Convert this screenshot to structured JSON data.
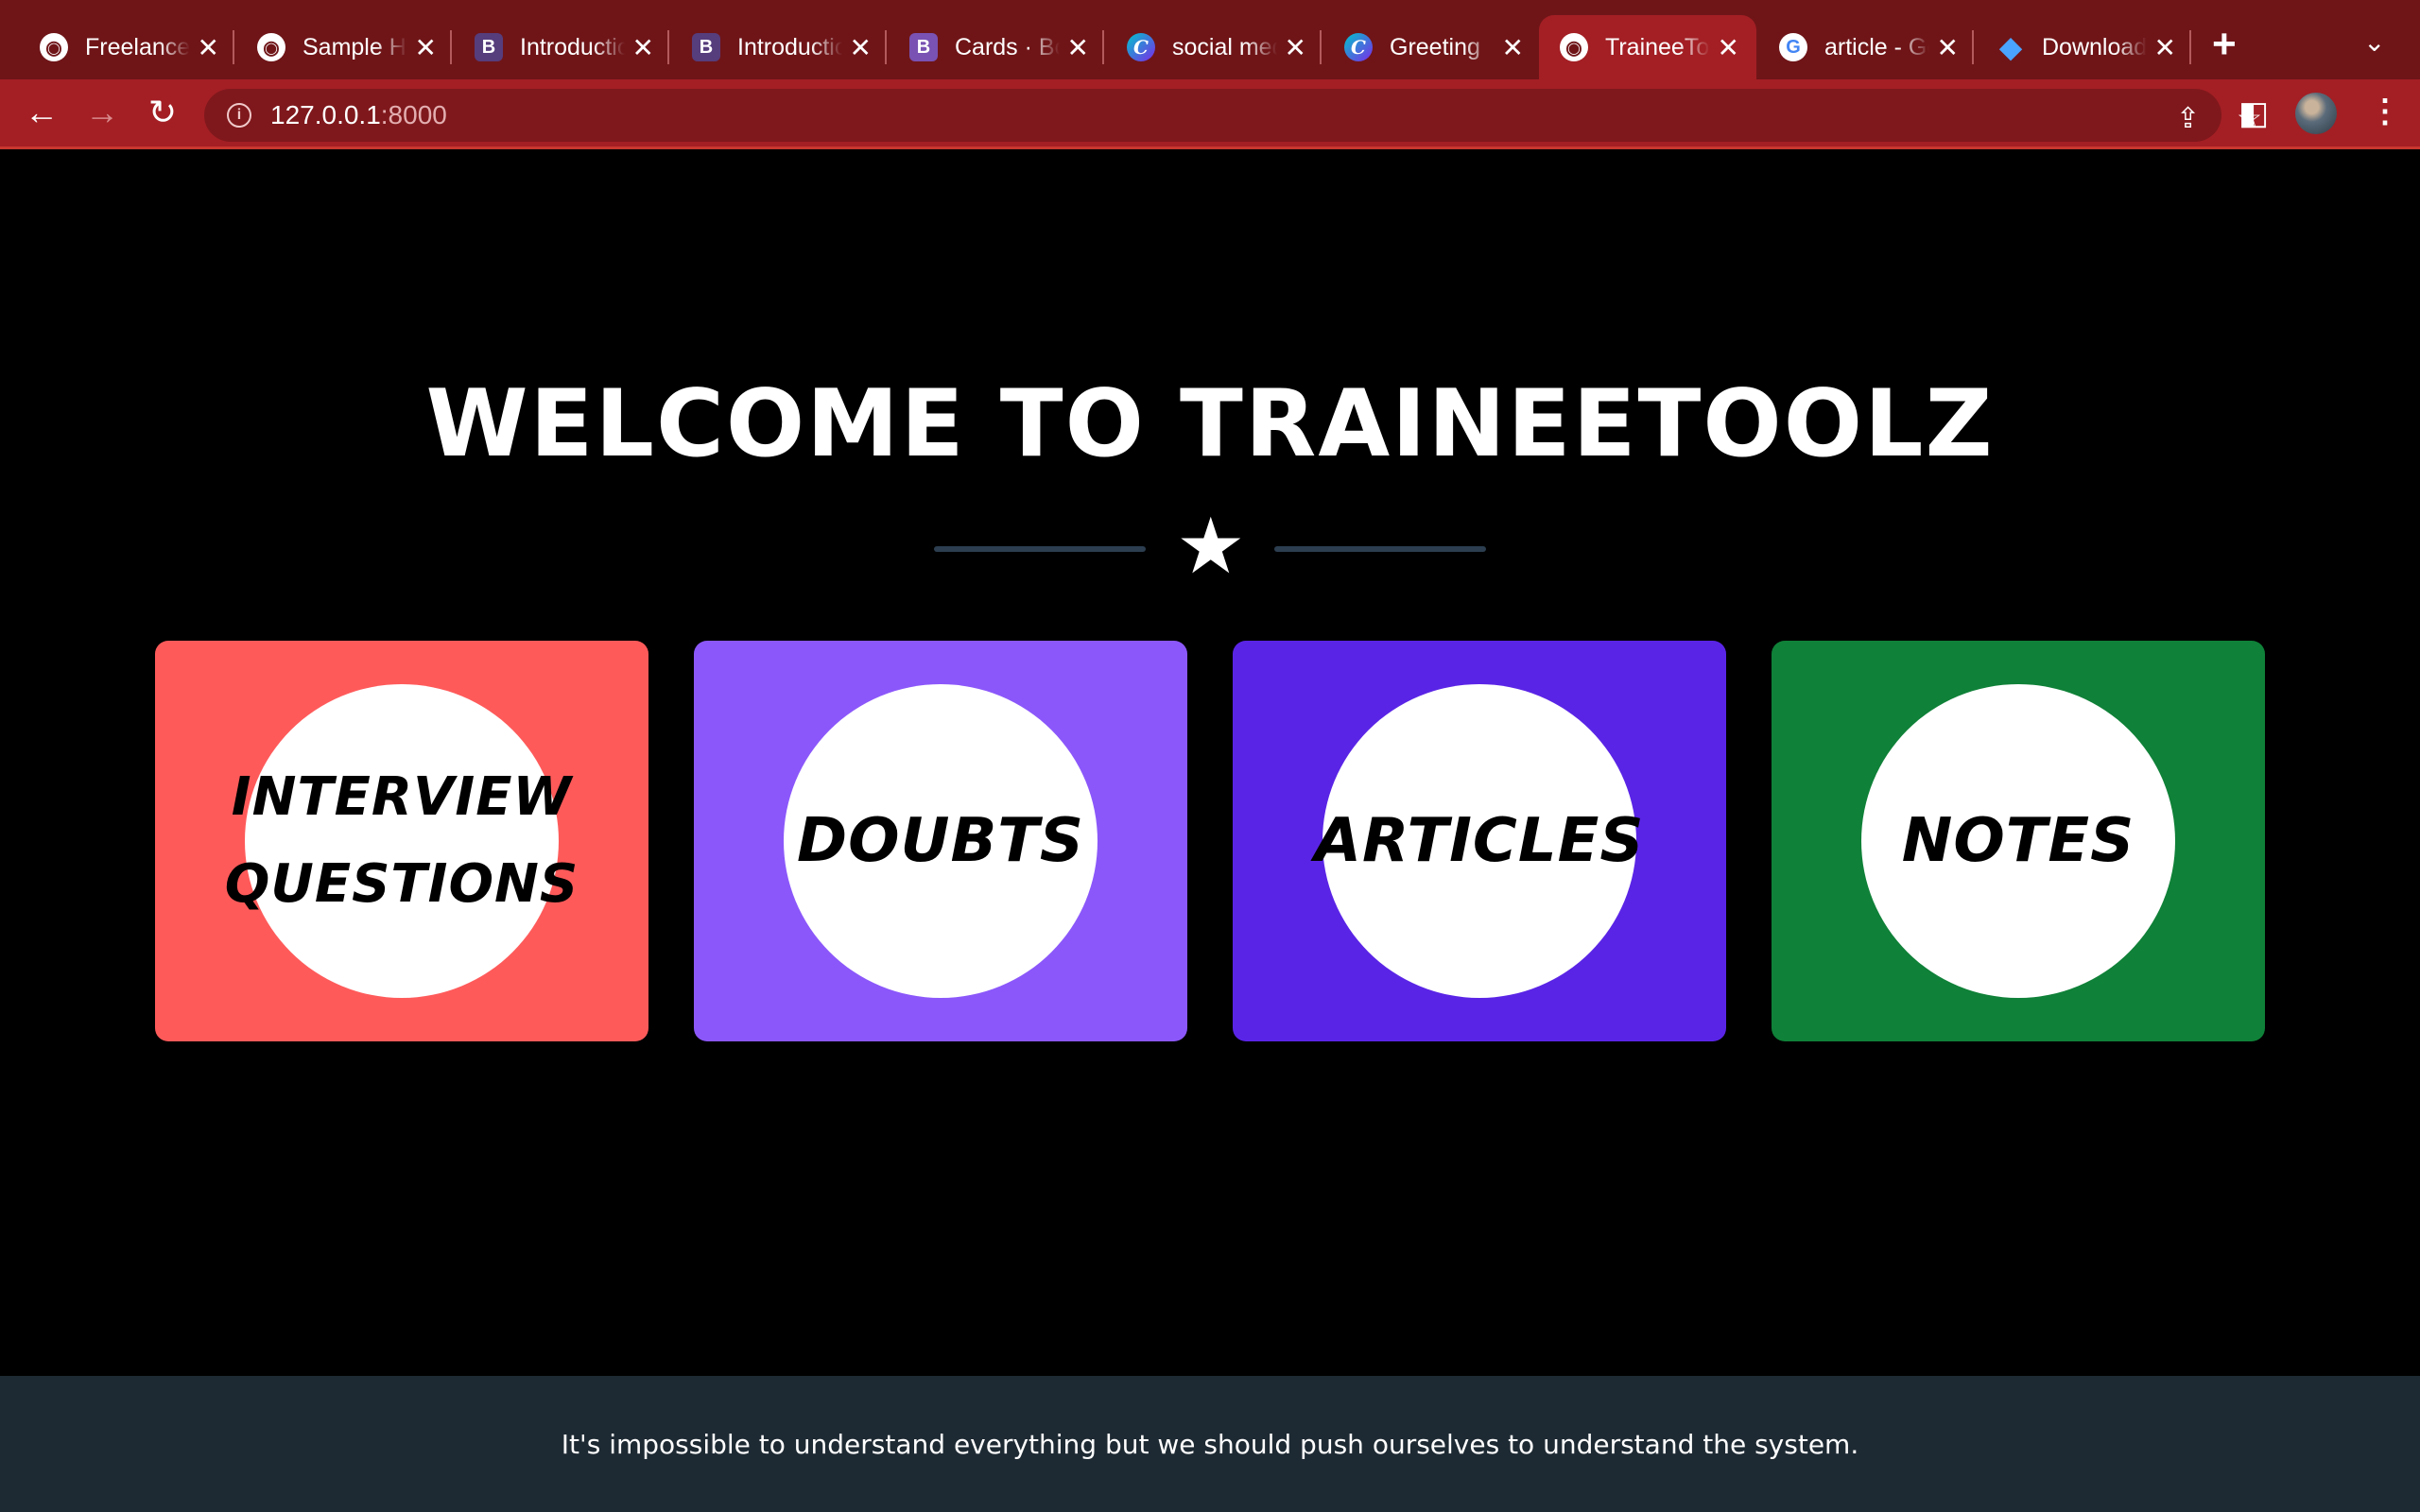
{
  "browser": {
    "tabs": [
      {
        "title": "Freelancer",
        "icon": "globe-icon"
      },
      {
        "title": "Sample HTML",
        "icon": "globe-icon"
      },
      {
        "title": "Introduction",
        "icon": "bootstrap-icon"
      },
      {
        "title": "Introduction",
        "icon": "bootstrap-icon"
      },
      {
        "title": "Cards · Bootstrap",
        "icon": "bootstrap-icon"
      },
      {
        "title": "social media",
        "icon": "canva-icon"
      },
      {
        "title": "Greeting",
        "icon": "canva-icon"
      },
      {
        "title": "TraineeToolz",
        "icon": "globe-icon",
        "active": true
      },
      {
        "title": "article - Google",
        "icon": "google-icon"
      },
      {
        "title": "Download",
        "icon": "gem-icon"
      }
    ],
    "url_host": "127.0.0.1",
    "url_port": ":8000",
    "accent_color": "#a31f24"
  },
  "page": {
    "title": "WELCOME TO TRAINEETOOLZ",
    "cards": [
      {
        "label": "INTERVIEW QUESTIONS",
        "color": "#ff5a5a"
      },
      {
        "label": "DOUBTS",
        "color": "#8b57fa"
      },
      {
        "label": "ARTICLES",
        "color": "#5a24e6"
      },
      {
        "label": "NOTES",
        "color": "#0f8138"
      }
    ],
    "footer_text": "It's impossible to understand everything but we should push ourselves to understand the system."
  }
}
